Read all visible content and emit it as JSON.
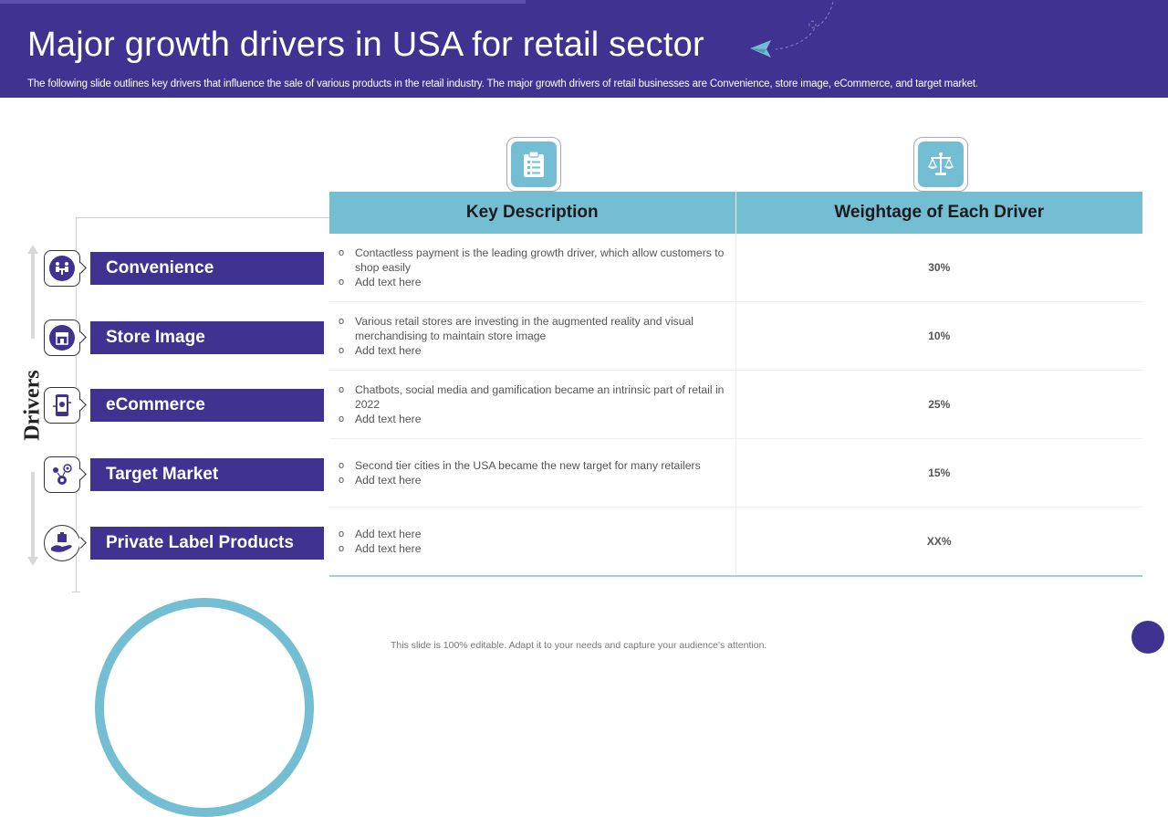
{
  "slide": {
    "title": "Major growth drivers in USA for retail sector",
    "subtitle": "The following slide outlines key drivers that influence the sale of various products in the retail industry. The major growth drivers of retail businesses are Convenience, store image, eCommerce, and target market.",
    "footer_note": "This slide is 100% editable. Adapt it to your needs and capture your audience's attention.",
    "side_label": "Drivers"
  },
  "colors": {
    "header_bg": "#3f3290",
    "table_header_bg": "#74bed4",
    "driver_bar_bg": "#3f3290"
  },
  "icons": {
    "description_column": "clipboard-checklist-icon",
    "weightage_column": "balance-scale-icon"
  },
  "table": {
    "headers": [
      "Key Description",
      "Weightage of Each Driver"
    ]
  },
  "drivers": [
    {
      "name": "Convenience",
      "icon": "people-meeting-icon",
      "description": [
        "Contactless payment is the leading growth driver, which allow customers to shop easily",
        "Add text here"
      ],
      "weightage": "30%"
    },
    {
      "name": "Store Image",
      "icon": "store-front-icon",
      "description": [
        "Various retail stores are investing in the augmented reality and visual merchandising to maintain store image",
        "Add text here"
      ],
      "weightage": "10%"
    },
    {
      "name": "eCommerce",
      "icon": "mobile-shopping-icon",
      "description": [
        "Chatbots, social media and gamification became an intrinsic part of retail in 2022",
        "Add text here"
      ],
      "weightage": "25%"
    },
    {
      "name": "Target Market",
      "icon": "target-gears-icon",
      "description": [
        "Second tier cities in the USA became the new target for many retailers",
        "Add text here"
      ],
      "weightage": "15%"
    },
    {
      "name": "Private Label Products",
      "icon": "hand-product-icon",
      "description": [
        "Add text here",
        "Add text here"
      ],
      "weightage": "XX%"
    }
  ]
}
